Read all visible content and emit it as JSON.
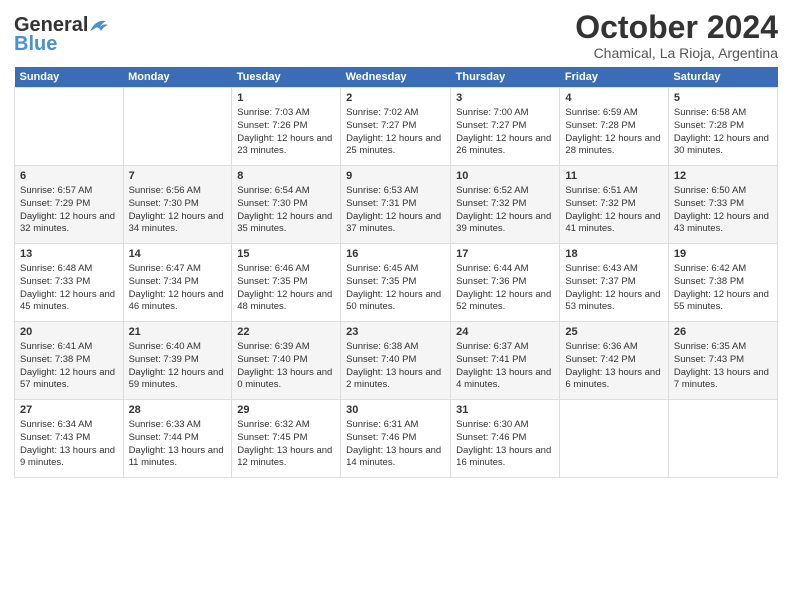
{
  "header": {
    "logo_line1": "General",
    "logo_line2": "Blue",
    "month": "October 2024",
    "location": "Chamical, La Rioja, Argentina"
  },
  "days_of_week": [
    "Sunday",
    "Monday",
    "Tuesday",
    "Wednesday",
    "Thursday",
    "Friday",
    "Saturday"
  ],
  "weeks": [
    [
      {
        "day": "",
        "sunrise": "",
        "sunset": "",
        "daylight": ""
      },
      {
        "day": "",
        "sunrise": "",
        "sunset": "",
        "daylight": ""
      },
      {
        "day": "1",
        "sunrise": "Sunrise: 7:03 AM",
        "sunset": "Sunset: 7:26 PM",
        "daylight": "Daylight: 12 hours and 23 minutes."
      },
      {
        "day": "2",
        "sunrise": "Sunrise: 7:02 AM",
        "sunset": "Sunset: 7:27 PM",
        "daylight": "Daylight: 12 hours and 25 minutes."
      },
      {
        "day": "3",
        "sunrise": "Sunrise: 7:00 AM",
        "sunset": "Sunset: 7:27 PM",
        "daylight": "Daylight: 12 hours and 26 minutes."
      },
      {
        "day": "4",
        "sunrise": "Sunrise: 6:59 AM",
        "sunset": "Sunset: 7:28 PM",
        "daylight": "Daylight: 12 hours and 28 minutes."
      },
      {
        "day": "5",
        "sunrise": "Sunrise: 6:58 AM",
        "sunset": "Sunset: 7:28 PM",
        "daylight": "Daylight: 12 hours and 30 minutes."
      }
    ],
    [
      {
        "day": "6",
        "sunrise": "Sunrise: 6:57 AM",
        "sunset": "Sunset: 7:29 PM",
        "daylight": "Daylight: 12 hours and 32 minutes."
      },
      {
        "day": "7",
        "sunrise": "Sunrise: 6:56 AM",
        "sunset": "Sunset: 7:30 PM",
        "daylight": "Daylight: 12 hours and 34 minutes."
      },
      {
        "day": "8",
        "sunrise": "Sunrise: 6:54 AM",
        "sunset": "Sunset: 7:30 PM",
        "daylight": "Daylight: 12 hours and 35 minutes."
      },
      {
        "day": "9",
        "sunrise": "Sunrise: 6:53 AM",
        "sunset": "Sunset: 7:31 PM",
        "daylight": "Daylight: 12 hours and 37 minutes."
      },
      {
        "day": "10",
        "sunrise": "Sunrise: 6:52 AM",
        "sunset": "Sunset: 7:32 PM",
        "daylight": "Daylight: 12 hours and 39 minutes."
      },
      {
        "day": "11",
        "sunrise": "Sunrise: 6:51 AM",
        "sunset": "Sunset: 7:32 PM",
        "daylight": "Daylight: 12 hours and 41 minutes."
      },
      {
        "day": "12",
        "sunrise": "Sunrise: 6:50 AM",
        "sunset": "Sunset: 7:33 PM",
        "daylight": "Daylight: 12 hours and 43 minutes."
      }
    ],
    [
      {
        "day": "13",
        "sunrise": "Sunrise: 6:48 AM",
        "sunset": "Sunset: 7:33 PM",
        "daylight": "Daylight: 12 hours and 45 minutes."
      },
      {
        "day": "14",
        "sunrise": "Sunrise: 6:47 AM",
        "sunset": "Sunset: 7:34 PM",
        "daylight": "Daylight: 12 hours and 46 minutes."
      },
      {
        "day": "15",
        "sunrise": "Sunrise: 6:46 AM",
        "sunset": "Sunset: 7:35 PM",
        "daylight": "Daylight: 12 hours and 48 minutes."
      },
      {
        "day": "16",
        "sunrise": "Sunrise: 6:45 AM",
        "sunset": "Sunset: 7:35 PM",
        "daylight": "Daylight: 12 hours and 50 minutes."
      },
      {
        "day": "17",
        "sunrise": "Sunrise: 6:44 AM",
        "sunset": "Sunset: 7:36 PM",
        "daylight": "Daylight: 12 hours and 52 minutes."
      },
      {
        "day": "18",
        "sunrise": "Sunrise: 6:43 AM",
        "sunset": "Sunset: 7:37 PM",
        "daylight": "Daylight: 12 hours and 53 minutes."
      },
      {
        "day": "19",
        "sunrise": "Sunrise: 6:42 AM",
        "sunset": "Sunset: 7:38 PM",
        "daylight": "Daylight: 12 hours and 55 minutes."
      }
    ],
    [
      {
        "day": "20",
        "sunrise": "Sunrise: 6:41 AM",
        "sunset": "Sunset: 7:38 PM",
        "daylight": "Daylight: 12 hours and 57 minutes."
      },
      {
        "day": "21",
        "sunrise": "Sunrise: 6:40 AM",
        "sunset": "Sunset: 7:39 PM",
        "daylight": "Daylight: 12 hours and 59 minutes."
      },
      {
        "day": "22",
        "sunrise": "Sunrise: 6:39 AM",
        "sunset": "Sunset: 7:40 PM",
        "daylight": "Daylight: 13 hours and 0 minutes."
      },
      {
        "day": "23",
        "sunrise": "Sunrise: 6:38 AM",
        "sunset": "Sunset: 7:40 PM",
        "daylight": "Daylight: 13 hours and 2 minutes."
      },
      {
        "day": "24",
        "sunrise": "Sunrise: 6:37 AM",
        "sunset": "Sunset: 7:41 PM",
        "daylight": "Daylight: 13 hours and 4 minutes."
      },
      {
        "day": "25",
        "sunrise": "Sunrise: 6:36 AM",
        "sunset": "Sunset: 7:42 PM",
        "daylight": "Daylight: 13 hours and 6 minutes."
      },
      {
        "day": "26",
        "sunrise": "Sunrise: 6:35 AM",
        "sunset": "Sunset: 7:43 PM",
        "daylight": "Daylight: 13 hours and 7 minutes."
      }
    ],
    [
      {
        "day": "27",
        "sunrise": "Sunrise: 6:34 AM",
        "sunset": "Sunset: 7:43 PM",
        "daylight": "Daylight: 13 hours and 9 minutes."
      },
      {
        "day": "28",
        "sunrise": "Sunrise: 6:33 AM",
        "sunset": "Sunset: 7:44 PM",
        "daylight": "Daylight: 13 hours and 11 minutes."
      },
      {
        "day": "29",
        "sunrise": "Sunrise: 6:32 AM",
        "sunset": "Sunset: 7:45 PM",
        "daylight": "Daylight: 13 hours and 12 minutes."
      },
      {
        "day": "30",
        "sunrise": "Sunrise: 6:31 AM",
        "sunset": "Sunset: 7:46 PM",
        "daylight": "Daylight: 13 hours and 14 minutes."
      },
      {
        "day": "31",
        "sunrise": "Sunrise: 6:30 AM",
        "sunset": "Sunset: 7:46 PM",
        "daylight": "Daylight: 13 hours and 16 minutes."
      },
      {
        "day": "",
        "sunrise": "",
        "sunset": "",
        "daylight": ""
      },
      {
        "day": "",
        "sunrise": "",
        "sunset": "",
        "daylight": ""
      }
    ]
  ]
}
